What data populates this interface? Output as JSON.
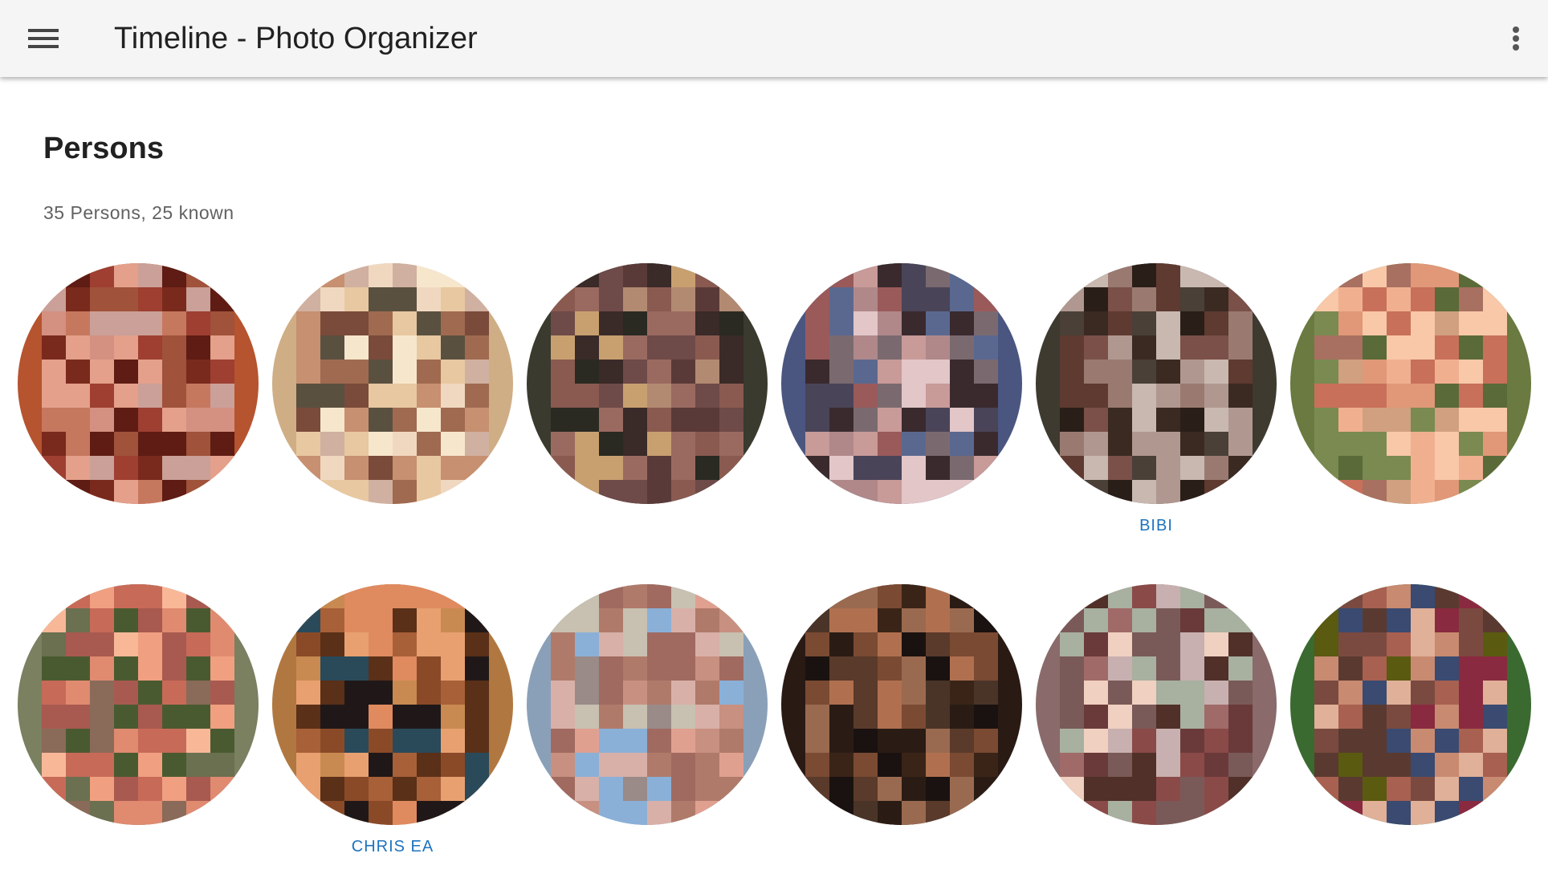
{
  "app": {
    "title": "Timeline - Photo Organizer"
  },
  "icons": {
    "menu": "hamburger-menu-icon",
    "more": "more-vertical-icon"
  },
  "page": {
    "title": "Persons",
    "summary": "35 Persons, 25 known"
  },
  "colors": {
    "appbar_bg": "#f5f5f5",
    "title_text": "#212121",
    "subtitle_text": "#616161",
    "name_link": "#1e73be"
  },
  "persons": [
    {
      "name": "",
      "border": "#b5542f",
      "palette": [
        "#7a2a1c",
        "#a0523a",
        "#c6785f",
        "#d49080",
        "#5e1c14",
        "#e4a08a",
        "#9e3f32",
        "#caa098"
      ]
    },
    {
      "name": "",
      "border": "#cfae86",
      "palette": [
        "#f6e6cc",
        "#e8c8a0",
        "#c79070",
        "#a06a50",
        "#7a4a3a",
        "#f0d8c0",
        "#5a5040",
        "#d0b0a0"
      ]
    },
    {
      "name": "",
      "border": "#3a3a2e",
      "palette": [
        "#3a2a28",
        "#6e4a48",
        "#9a6a60",
        "#b28a72",
        "#5a3a38",
        "#c8a070",
        "#2a2a22",
        "#8a5a50"
      ]
    },
    {
      "name": "",
      "border": "#4a5680",
      "palette": [
        "#4a4458",
        "#7a6a70",
        "#b0888a",
        "#c89a98",
        "#3a2a2e",
        "#e2c6c8",
        "#5a6890",
        "#9a5a5a"
      ]
    },
    {
      "name": "BIBI",
      "border": "#3e3a30",
      "palette": [
        "#3a2a22",
        "#5e3a30",
        "#7a5048",
        "#2a1e18",
        "#9a7a70",
        "#c8b8b0",
        "#4a4038",
        "#b09890"
      ]
    },
    {
      "name": "",
      "border": "#6a7a40",
      "palette": [
        "#f0b090",
        "#e09878",
        "#c8705a",
        "#a87060",
        "#5a6a38",
        "#7a8a50",
        "#f8c8a8",
        "#d0a080"
      ]
    },
    {
      "name": "",
      "border": "#7a8060",
      "palette": [
        "#f0a080",
        "#e08a70",
        "#c86a58",
        "#a85a50",
        "#6a7050",
        "#4a5a30",
        "#f8b898",
        "#8a6a58"
      ]
    },
    {
      "name": "CHRIS EA",
      "border": "#b07840",
      "palette": [
        "#c88a50",
        "#a86038",
        "#e08a60",
        "#8a4a28",
        "#5a3018",
        "#201818",
        "#2a4a5a",
        "#e8a070"
      ]
    },
    {
      "name": "",
      "border": "#8aa0b8",
      "palette": [
        "#c89080",
        "#e0a090",
        "#b07a6a",
        "#a06a60",
        "#d8b0a8",
        "#8ab0d8",
        "#c8c0b0",
        "#9a8a88"
      ]
    },
    {
      "name": "",
      "border": "#2a1a14",
      "palette": [
        "#5a3a2a",
        "#7a4a32",
        "#b07050",
        "#3a2418",
        "#1a1210",
        "#9a6a50",
        "#4a3428",
        "#2a1c14"
      ]
    },
    {
      "name": "",
      "border": "#8a6a6a",
      "palette": [
        "#6a3a3a",
        "#8a4a48",
        "#a06a68",
        "#503028",
        "#c8b0b0",
        "#f0d0c0",
        "#7a5a58",
        "#a8b0a0"
      ]
    },
    {
      "name": "",
      "border": "#3a6a30",
      "palette": [
        "#c88a70",
        "#a86050",
        "#7a4a40",
        "#5a3a30",
        "#3a4a70",
        "#8a2a40",
        "#5a5a10",
        "#e0b098"
      ]
    }
  ]
}
